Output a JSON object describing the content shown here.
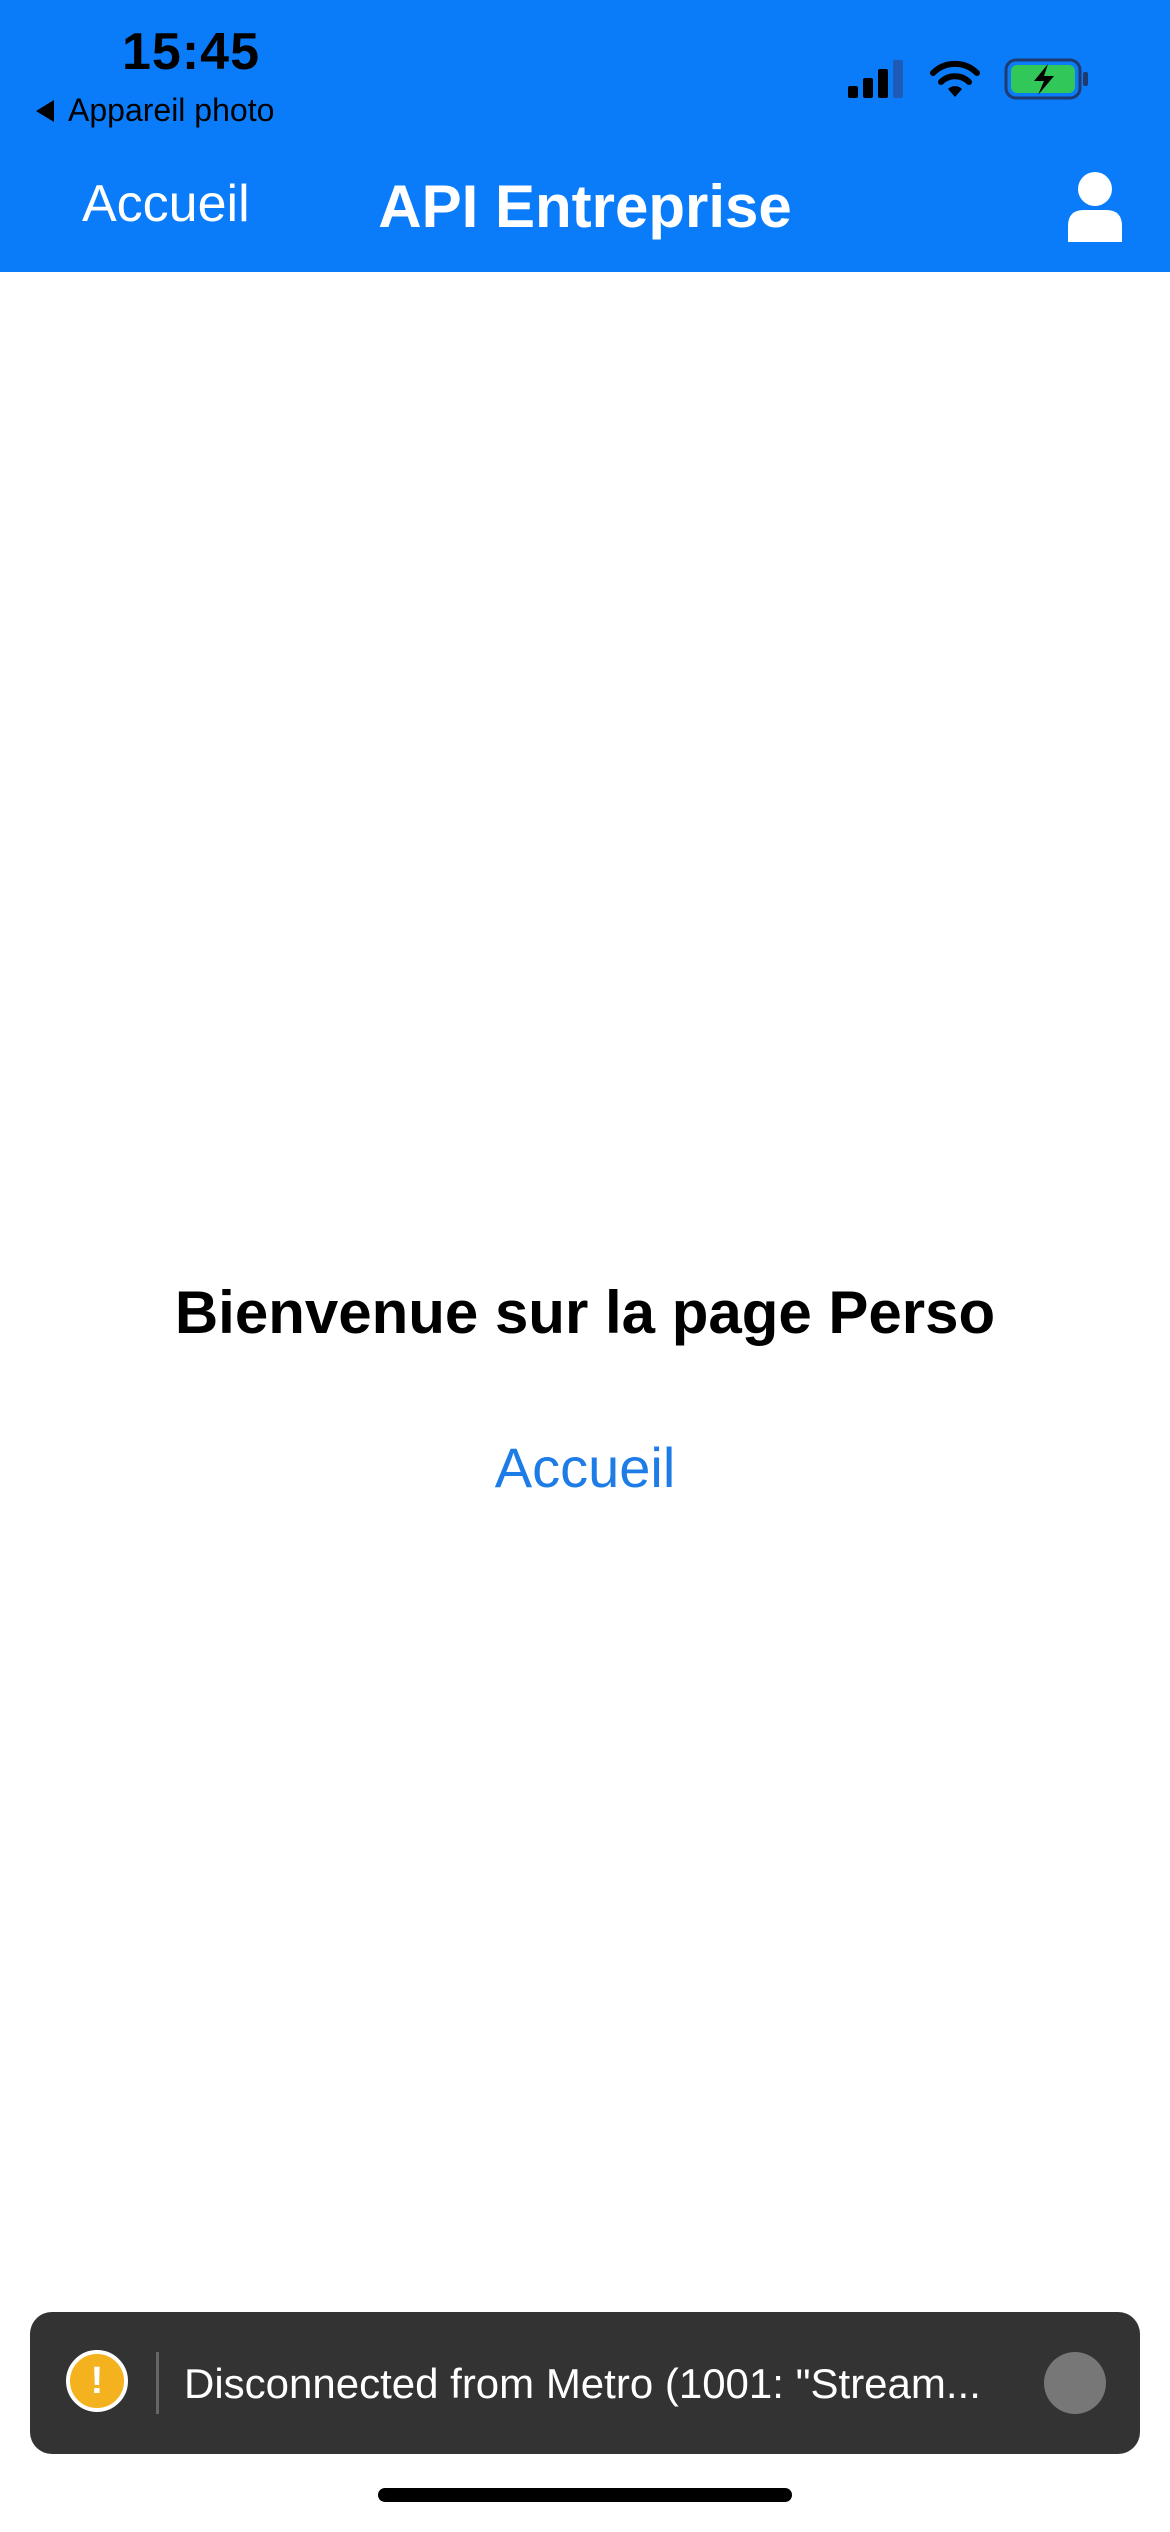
{
  "status_bar": {
    "time": "15:45",
    "back_app_label": "Appareil photo",
    "icons": [
      "cellular-signal-icon",
      "wifi-icon",
      "battery-charging-icon"
    ]
  },
  "nav": {
    "left_label": "Accueil",
    "title": "API Entreprise",
    "right_icon": "user-icon"
  },
  "main": {
    "welcome_text": "Bienvenue sur la page Perso",
    "home_link": "Accueil"
  },
  "toast": {
    "icon": "warning-icon",
    "message": "Disconnected from Metro (1001: \"Stream...",
    "dismiss_icon": "dismiss-icon"
  },
  "colors": {
    "header_bg": "#0a7cfa",
    "link": "#1d7ce6",
    "toast_bg": "#333333",
    "warning": "#f4b21f",
    "battery_fill": "#32c759"
  }
}
